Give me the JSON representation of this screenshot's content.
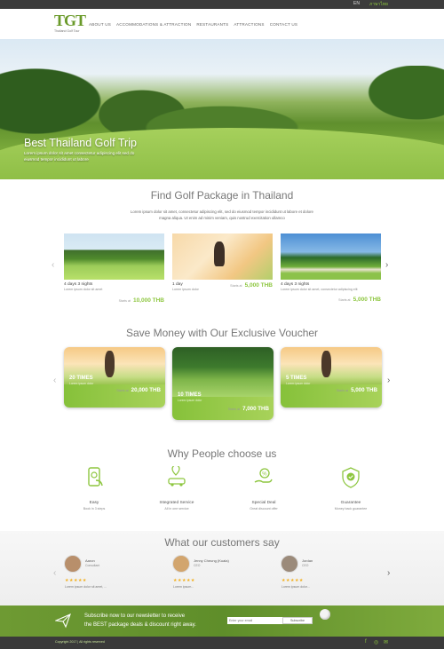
{
  "topbar": {
    "lang_en": "EN",
    "lang_th": "ภาษาไทย"
  },
  "brand": {
    "logo": "TGT",
    "tagline": "Thailand Golf Tour"
  },
  "nav": [
    "ABOUT US",
    "ACCOMMODATIONS & ATTRACTION",
    "RESTAURANTS",
    "ATTRACTIONS",
    "CONTACT US"
  ],
  "hero": {
    "title": "Best Thailand Golf Trip",
    "text": "Lorem ipsum dolor sit amet consectetur adipiscing elit sed do eiusmod tempor incididunt ut labore"
  },
  "packages": {
    "title": "Find Golf Package in Thailand",
    "description": "Lorem ipsum dolor sit amet, consectetur adipiscing elit, sed do eiusmod tempor incididunt ut labore et dolore magna aliqua. Ut enim ad minim veniam, quis nostrud exercitation ullamco",
    "items": [
      {
        "name": "4 days 3 nights",
        "sub": "Lorem ipsum dolor sit amet",
        "price_label": "Starts at",
        "price": "10,000 THB"
      },
      {
        "name": "1 day",
        "sub": "Lorem ipsum dolor",
        "price_label": "Starts at",
        "price": "5,000 THB"
      },
      {
        "name": "4 days 3 nights",
        "sub": "Lorem ipsum dolor sit amet, consectetur adipiscing elit",
        "price_label": "Starts at",
        "price": "5,000 THB"
      }
    ]
  },
  "vouchers": {
    "title": "Save Money with Our Exclusive Voucher",
    "items": [
      {
        "times": "20 TIMES",
        "sub": "Lorem ipsum dolor",
        "price_label": "Starts at",
        "price": "20,000 THB"
      },
      {
        "times": "10 TIMES",
        "sub": "Lorem ipsum dolor",
        "price_label": "Starts at",
        "price": "7,000 THB"
      },
      {
        "times": "5 TIMES",
        "sub": "Lorem ipsum dolor",
        "price_label": "Starts at",
        "price": "5,000 THB"
      }
    ]
  },
  "why": {
    "title": "Why People choose us",
    "items": [
      {
        "title": "Easy",
        "sub": "Book in 3 steps"
      },
      {
        "title": "Integrated Service",
        "sub": "All in one service"
      },
      {
        "title": "Special Deal",
        "sub": "Great discount offer"
      },
      {
        "title": "Guarantee",
        "sub": "Money back guarantee"
      }
    ]
  },
  "testimonials": {
    "title": "What our customers say",
    "stars": "★★★★★",
    "items": [
      {
        "name": "Aaron",
        "role": "Consultant",
        "quote": "Lorem ipsum dolor sit amet, ..."
      },
      {
        "name": "Jenny Cheung (Kuala)",
        "role": "CEO",
        "quote": "Lorem ipsum..."
      },
      {
        "name": "Jordan",
        "role": "CEO",
        "quote": "Lorem ipsum dolor..."
      }
    ]
  },
  "newsletter": {
    "line1": "Subscribe now to our newsletter to receive",
    "line2": "the BEST package deals & discount right away.",
    "placeholder": "Enter your email",
    "button": "Subscribe"
  },
  "footer": {
    "copyright": "Copyright 2017 | All rights reserved"
  }
}
